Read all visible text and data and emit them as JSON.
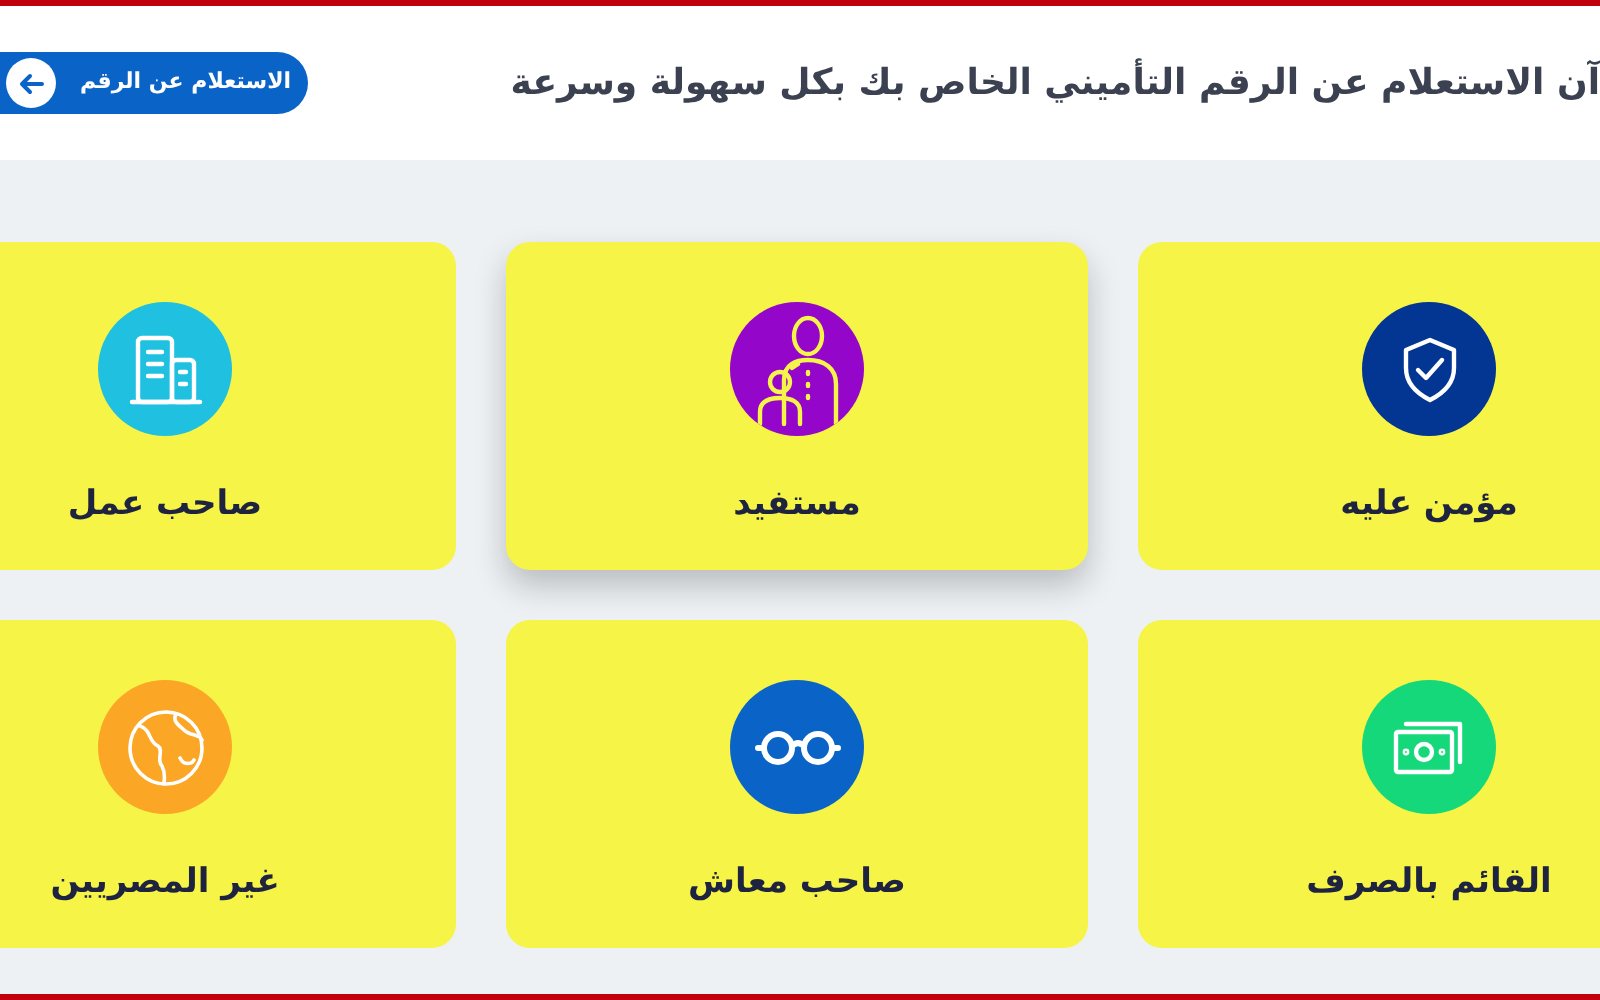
{
  "header": {
    "headline": "آن الاستعلام عن الرقم التأميني الخاص بك بكل سهولة وسرعة",
    "button": {
      "label": "الاستعلام عن الرقم"
    }
  },
  "cards": [
    {
      "label": "مؤمن عليه",
      "kind": "shield",
      "color": "#023692",
      "highlighted": false
    },
    {
      "label": "مستفيد",
      "kind": "family",
      "color": "#9406c9",
      "highlighted": true
    },
    {
      "label": "صاحب عمل",
      "kind": "building",
      "color": "#1fc0e0",
      "highlighted": false
    },
    {
      "label": "القائم بالصرف",
      "kind": "money",
      "color": "#14d87a",
      "highlighted": false
    },
    {
      "label": "صاحب معاش",
      "kind": "glasses",
      "color": "#0a64c8",
      "highlighted": false
    },
    {
      "label": "غير المصريين",
      "kind": "globe",
      "color": "#fca626",
      "highlighted": false
    }
  ]
}
